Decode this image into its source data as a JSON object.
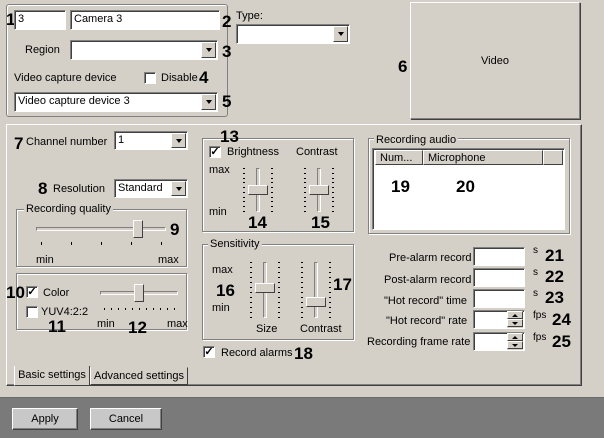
{
  "camera": {
    "id_value": "3",
    "name_value": "Camera 3",
    "type_label": "Type:",
    "type_value": "",
    "region_label": "Region",
    "region_value": "",
    "capture_label": "Video capture device",
    "disable_label": "Disable",
    "disable_checked": false,
    "capture_value": "Video capture device 3",
    "video_label": "Video"
  },
  "channel": {
    "channel_label": "Channel number",
    "channel_value": "1",
    "resolution_label": "Resolution",
    "resolution_value": "Standard",
    "quality_title": "Recording quality",
    "quality_min": "min",
    "quality_max": "max",
    "quality_level": 0.81,
    "color_label": "Color",
    "color_checked": true,
    "yuv_label": "YUV4:2:2",
    "yuv_checked": false,
    "color_min": "min",
    "color_max": "max",
    "color_level": 0.5
  },
  "image": {
    "brightness_label": "Brightness",
    "brightness_checked": true,
    "contrast_label": "Contrast",
    "max_label": "max",
    "min_label": "min",
    "brightness_level": 0.5,
    "contrast_level": 0.5
  },
  "sensitivity": {
    "title": "Sensitivity",
    "max_label": "max",
    "min_label": "min",
    "size_label": "Size",
    "contrast_label": "Contrast",
    "size_level": 0.55,
    "contrast_level": 0.25
  },
  "record_alarms": {
    "label": "Record alarms",
    "checked": true
  },
  "audio": {
    "title": "Recording audio",
    "col_num": "Num...",
    "col_mic": "Microphone"
  },
  "recording": {
    "prealarm_label": "Pre-alarm record",
    "prealarm_value": "",
    "prealarm_unit": "s",
    "postalarm_label": "Post-alarm record",
    "postalarm_value": "",
    "postalarm_unit": "s",
    "hot_time_label": "\"Hot record\" time",
    "hot_time_value": "",
    "hot_time_unit": "s",
    "hot_rate_label": "\"Hot record\" rate",
    "hot_rate_value": "",
    "hot_rate_unit": "fps",
    "frame_rate_label": "Recording frame rate",
    "frame_rate_value": "",
    "frame_rate_unit": "fps"
  },
  "tabs": {
    "basic": "Basic settings",
    "advanced": "Advanced settings"
  },
  "buttons": {
    "apply": "Apply",
    "cancel": "Cancel"
  },
  "callouts": {
    "c1": "1",
    "c2": "2",
    "c3": "3",
    "c4": "4",
    "c5": "5",
    "c6": "6",
    "c7": "7",
    "c8": "8",
    "c9": "9",
    "c10": "10",
    "c11": "11",
    "c12": "12",
    "c13": "13",
    "c14": "14",
    "c15": "15",
    "c16": "16",
    "c17": "17",
    "c18": "18",
    "c19": "19",
    "c20": "20",
    "c21": "21",
    "c22": "22",
    "c23": "23",
    "c24": "24",
    "c25": "25"
  },
  "icons": {
    "dropdown": "chevron-down-icon",
    "check": "checkmark-icon",
    "spin_up": "spin-up-icon",
    "spin_down": "spin-down-icon"
  }
}
